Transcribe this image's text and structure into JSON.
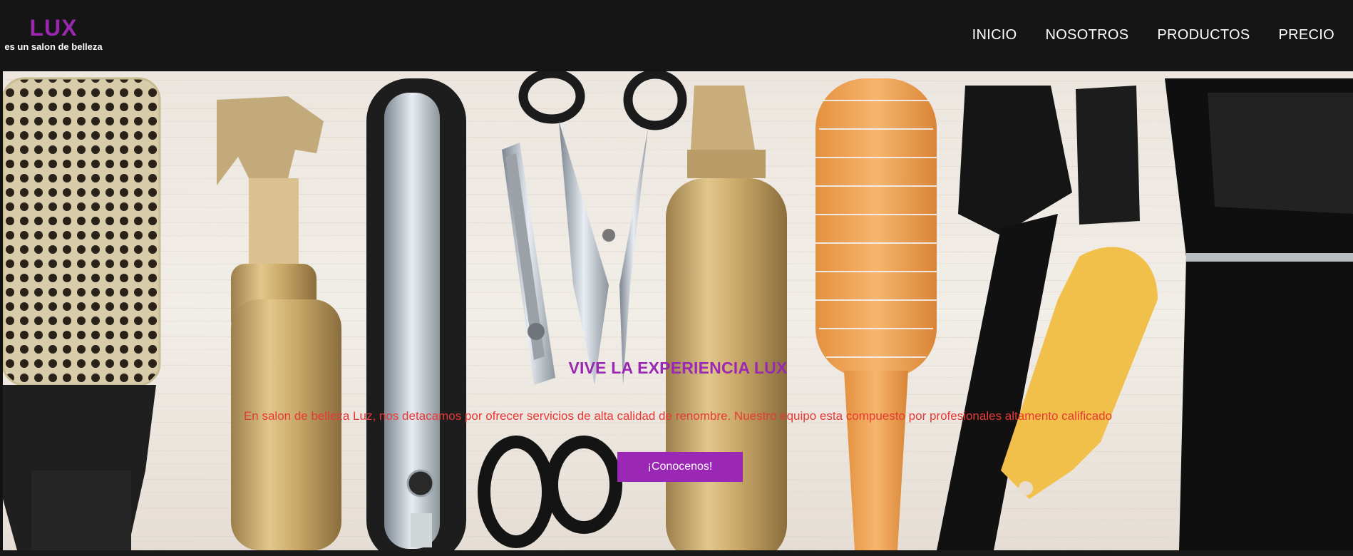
{
  "header": {
    "logo_title": "LUX",
    "logo_subtitle": "es un salon de belleza"
  },
  "nav": {
    "items": [
      "INICIO",
      "NOSOTROS",
      "PRODUCTOS",
      "PRECIO"
    ]
  },
  "hero": {
    "title": "VIVE LA EXPERIENCIA LUX",
    "description": "En salon de belleza Luz, nos detacamos por ofrecer servicios de alta calidad de renombre. Nuestro equipo esta compuesto por profesionales altamento calificado",
    "button_label": "¡Conocenos!",
    "image": "hair-salon-tools-photo"
  },
  "colors": {
    "brand": "#9a28b4",
    "text_accent": "#e53935",
    "header_bg": "#151515"
  }
}
